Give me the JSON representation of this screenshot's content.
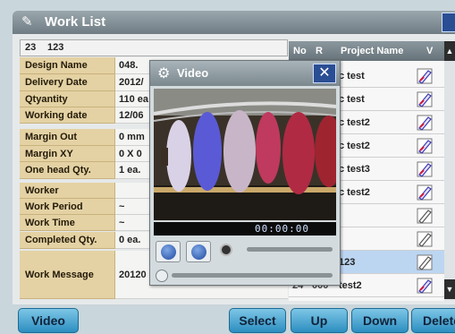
{
  "window": {
    "title": "Work List"
  },
  "idbar": {
    "num": "23",
    "code": "123"
  },
  "info": [
    {
      "label": "Design Name",
      "value": "048."
    },
    {
      "label": "Delivery Date",
      "value": "2012/"
    },
    {
      "label": "Qtyantity",
      "value": "110 ea"
    },
    {
      "label": "Working date",
      "value": "12/06"
    },
    {
      "label": "Margin Out",
      "value": "0 mm"
    },
    {
      "label": "Margin XY",
      "value": "0 X 0"
    },
    {
      "label": "One head Qty.",
      "value": "1 ea."
    },
    {
      "label": "Worker",
      "value": ""
    },
    {
      "label": "Work Period",
      "value": "~"
    },
    {
      "label": "Work Time",
      "value": "~"
    },
    {
      "label": "Completed Qty.",
      "value": "0 ea."
    },
    {
      "label": "Work Message",
      "value": "20120"
    }
  ],
  "table": {
    "headers": {
      "no": "No",
      "r": "R",
      "project": "Project Name",
      "v": "V"
    },
    "rows": [
      {
        "no": "",
        "r": "",
        "project": "c test",
        "selected": false,
        "icon": "needle-edit-icon"
      },
      {
        "no": "",
        "r": "",
        "project": "c test",
        "selected": false,
        "icon": "needle-edit-icon"
      },
      {
        "no": "",
        "r": "",
        "project": "c test2",
        "selected": false,
        "icon": "needle-edit-icon"
      },
      {
        "no": "",
        "r": "",
        "project": "c test2",
        "selected": false,
        "icon": "needle-edit-icon"
      },
      {
        "no": "",
        "r": "",
        "project": "c test3",
        "selected": false,
        "icon": "needle-edit-icon"
      },
      {
        "no": "",
        "r": "",
        "project": "c test2",
        "selected": false,
        "icon": "needle-edit-icon"
      },
      {
        "no": "",
        "r": "",
        "project": "",
        "selected": false,
        "icon": "needle-outline-icon"
      },
      {
        "no": "",
        "r": "",
        "project": "",
        "selected": false,
        "icon": "needle-outline-icon"
      },
      {
        "no": "",
        "r": "",
        "project": "123",
        "selected": true,
        "icon": "needle-outline-icon"
      },
      {
        "no": "24",
        "r": "000",
        "project": "test2",
        "selected": false,
        "icon": "needle-edit-icon"
      }
    ]
  },
  "video": {
    "title": "Video",
    "time": "00:00:00"
  },
  "buttons": {
    "video": "Video",
    "select": "Select",
    "up": "Up",
    "down": "Down",
    "delete": "Delete"
  },
  "colors": {
    "accent": "#2c8ec0",
    "title_bar": "#7b888e",
    "label_bg": "#e4d2a4",
    "selected_row": "#bcd6f2"
  }
}
